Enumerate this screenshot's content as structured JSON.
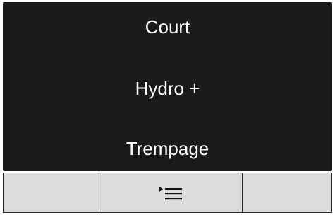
{
  "menu": {
    "items": [
      {
        "label": "Court"
      },
      {
        "label": "Hydro +"
      },
      {
        "label": "Trempage"
      }
    ]
  },
  "softkeys": {
    "left": {
      "label": ""
    },
    "center": {
      "icon": "menu-list-icon"
    },
    "right": {
      "label": ""
    }
  },
  "colors": {
    "screen_background": "#1a1a1a",
    "menu_text": "#ffffff",
    "softkey_background": "#dcdcdc",
    "border": "#2a2a2a"
  }
}
